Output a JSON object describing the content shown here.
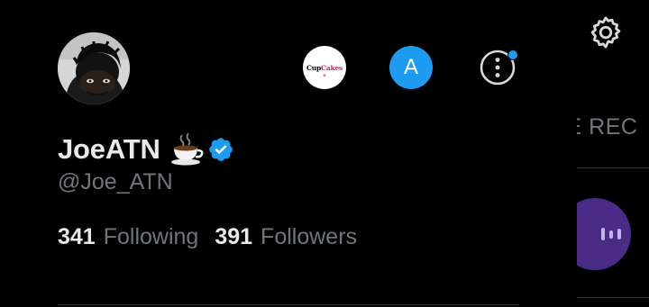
{
  "profile": {
    "display_name": "JoeATN",
    "name_emoji": "coffee-cup",
    "verified": true,
    "handle": "@Joe_ATN",
    "following_count": "341",
    "following_label": "Following",
    "followers_count": "391",
    "followers_label": "Followers"
  },
  "accounts": {
    "cupcakes": {
      "logo_part1": "Cup",
      "logo_part2": "Cakes",
      "icon": "cupcakes-logo"
    },
    "a": {
      "letter": "A",
      "color": "#1d9bf0"
    }
  },
  "more_options": {
    "icon": "more-vertical-circle",
    "has_notification_dot": true
  },
  "background": {
    "section_title": "HE REC",
    "settings_icon": "gear-icon",
    "audio_icon": "audio-waveform-icon",
    "audio_color": "#4a2b85"
  },
  "colors": {
    "background": "#000000",
    "primary_text": "#e7e9ea",
    "secondary_text": "#71767b",
    "accent": "#1d9bf0",
    "divider": "#2f3336"
  }
}
